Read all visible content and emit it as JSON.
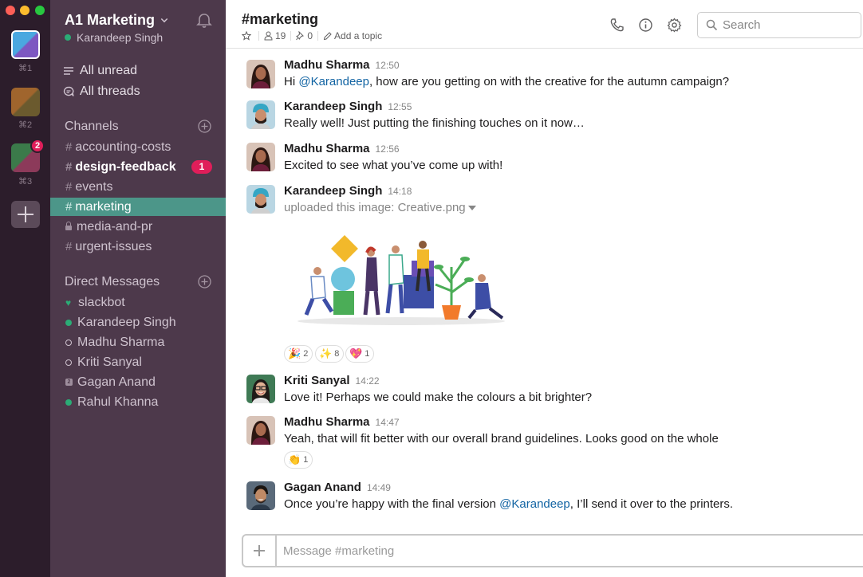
{
  "workspaces": [
    {
      "shortcut": "⌘1",
      "color_a": "#4aa8e0",
      "color_b": "#7d57c1"
    },
    {
      "shortcut": "⌘2",
      "color_a": "#a0652d",
      "color_b": "#6b5a2e"
    },
    {
      "shortcut": "⌘3",
      "color_a": "#3b7a4a",
      "color_b": "#8c3a5a",
      "badge": "2"
    }
  ],
  "sidebar": {
    "team_name": "A1 Marketing",
    "user": "Karandeep Singh",
    "nav": [
      {
        "label": "All unread",
        "icon": "list-icon"
      },
      {
        "label": "All threads",
        "icon": "threads-icon"
      }
    ],
    "channels_title": "Channels",
    "channels": [
      {
        "name": "accounting-costs",
        "prefix": "#"
      },
      {
        "name": "design-feedback",
        "prefix": "#",
        "badge": "1",
        "bold": true
      },
      {
        "name": "events",
        "prefix": "#"
      },
      {
        "name": "marketing",
        "prefix": "#",
        "active": true
      },
      {
        "name": "media-and-pr",
        "prefix": "lock"
      },
      {
        "name": "urgent-issues",
        "prefix": "#"
      }
    ],
    "dm_title": "Direct Messages",
    "dms": [
      {
        "name": "slackbot",
        "status": "heart"
      },
      {
        "name": "Karandeep Singh",
        "status": "online"
      },
      {
        "name": "Madhu Sharma",
        "status": "away"
      },
      {
        "name": "Kriti Sanyal",
        "status": "away"
      },
      {
        "name": "Gagan Anand",
        "status": "group",
        "group_count": "2"
      },
      {
        "name": "Rahul Khanna",
        "status": "online"
      }
    ]
  },
  "header": {
    "channel": "#marketing",
    "members": "19",
    "pins": "0",
    "add_topic": "Add a topic",
    "search_placeholder": "Search"
  },
  "messages": [
    {
      "author": "Madhu Sharma",
      "time": "12:50",
      "pre": "Hi ",
      "mention": "@Karandeep",
      "post": ", how are you getting on with the creative for the autumn campaign?"
    },
    {
      "author": "Karandeep Singh",
      "time": "12:55",
      "text": "Really well! Just putting the finishing touches on it now…"
    },
    {
      "author": "Madhu Sharma",
      "time": "12:56",
      "text": "Excited to see what you’ve come up with!"
    },
    {
      "author": "Karandeep Singh",
      "time": "14:18",
      "upload": "uploaded this image: Creative.png"
    },
    {
      "author": "Kriti Sanyal",
      "time": "14:22",
      "text": "Love it! Perhaps we could make the colours a bit brighter?"
    },
    {
      "author": "Madhu Sharma",
      "time": "14:47",
      "text": "Yeah, that will fit better with our overall brand guidelines. Looks good on the whole"
    },
    {
      "author": "Gagan Anand",
      "time": "14:49",
      "pre": "Once you’re happy with the final version ",
      "mention": "@Karandeep",
      "post": ", I’ll send it over to the printers."
    }
  ],
  "reactions_image": [
    {
      "emoji": "🎉",
      "count": "2"
    },
    {
      "emoji": "✨",
      "count": "8"
    },
    {
      "emoji": "💖",
      "count": "1"
    }
  ],
  "reactions_madhu": [
    {
      "emoji": "👏",
      "count": "1"
    }
  ],
  "composer": {
    "placeholder": "Message #marketing"
  },
  "colors": {
    "sidebar": "#4d394b",
    "rail": "#2c1d2b",
    "active_channel": "#4c9689",
    "badge": "#e01e5a",
    "mention": "#1264a3",
    "online": "#2bac76"
  }
}
